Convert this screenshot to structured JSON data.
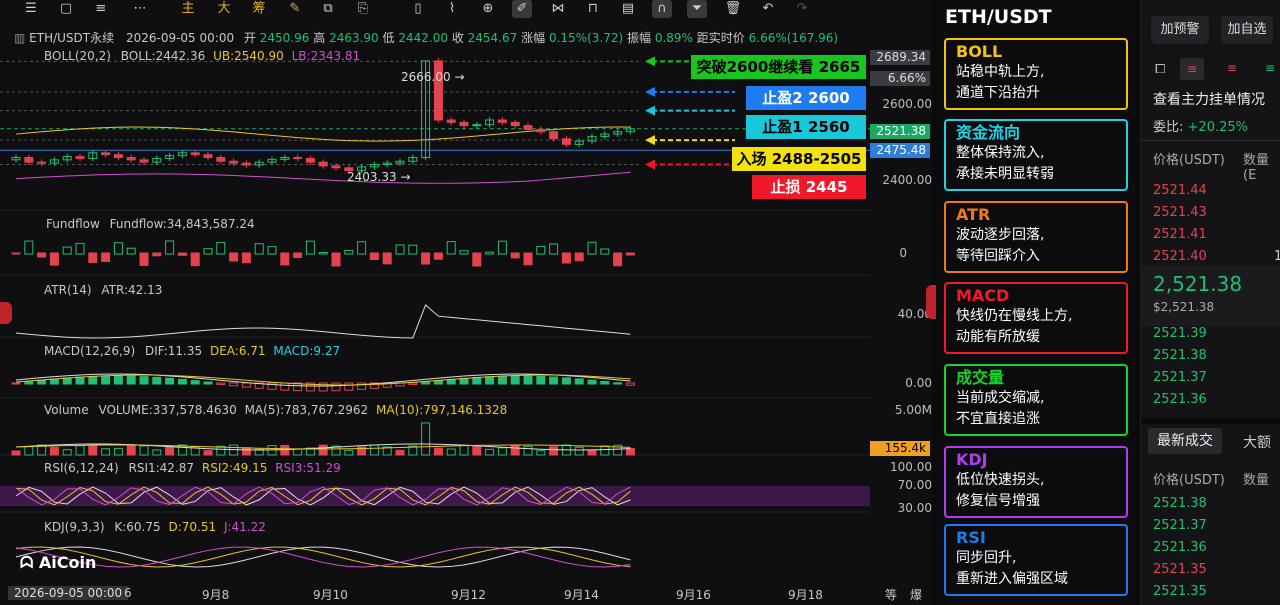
{
  "toolbar": {
    "icons": [
      "menu-icon",
      "square-icon",
      "sliders-icon",
      "more-dots-icon"
    ],
    "buttons": [
      "主",
      "大",
      "筹"
    ],
    "tools": [
      "draw-icon",
      "copy-icon",
      "bookmark-icon",
      "ruler-icon",
      "zoom-icon",
      "pen-icon",
      "symmetry-icon",
      "lock-icon",
      "note-icon",
      "magnet-icon",
      "filter-icon",
      "trash-icon",
      "undo-icon",
      "redo-icon"
    ]
  },
  "header": {
    "symbol": "ETH/USDT永续",
    "time": "2026-09-05 00:00",
    "open_l": "开",
    "open": "2450.96",
    "high_l": "高",
    "high": "2463.90",
    "low_l": "低",
    "low": "2442.00",
    "close_l": "收",
    "close": "2454.67",
    "chg_l": "涨幅",
    "chg": "0.15%(3.72)",
    "amp_l": "振幅",
    "amp": "0.89%",
    "dist_l": "距实时价",
    "dist": "6.66%(167.96)"
  },
  "boll": {
    "name": "BOLL(20,2)",
    "mid": "BOLL:2442.36",
    "ub": "UB:2540.90",
    "lb": "LB:2343.81"
  },
  "fundflow": {
    "name": "Fundflow",
    "value": "Fundflow:34,843,587.24"
  },
  "atr": {
    "name": "ATR(14)",
    "value": "ATR:42.13"
  },
  "macd": {
    "name": "MACD(12,26,9)",
    "dif": "DIF:11.35",
    "dea": "DEA:6.71",
    "macd": "MACD:9.27"
  },
  "volume": {
    "name": "Volume",
    "vol": "VOLUME:337,578.4630",
    "ma5": "MA(5):783,767.2962",
    "ma10": "MA(10):797,146.1328"
  },
  "rsi": {
    "name": "RSI(6,12,24)",
    "r1": "RSI1:42.87",
    "r2": "RSI2:49.15",
    "r3": "RSI3:51.29"
  },
  "kdj": {
    "name": "KDJ(9,3,3)",
    "k": "K:60.75",
    "d": "D:70.51",
    "j": "J:41.22"
  },
  "annot": {
    "high": "2666.00",
    "low": "2403.33"
  },
  "targets": [
    {
      "label": "突破2600继续看 2665",
      "bg": "#18c41e",
      "fg": "#000000"
    },
    {
      "label": "止盈2 2600",
      "bg": "#1e7bf0",
      "fg": "#ffffff"
    },
    {
      "label": "止盈1 2560",
      "bg": "#18c8d8",
      "fg": "#000000"
    },
    {
      "label": "入场 2488-2505",
      "bg": "#f2e10c",
      "fg": "#000000"
    },
    {
      "label": "止损 2445",
      "bg": "#f0192a",
      "fg": "#ffffff"
    }
  ],
  "price_axis": {
    "top_tag": "2689.34",
    "top_pct": "6.66%",
    "p2600": "2600.00",
    "last": "2521.38",
    "boll_mid": "2475.48",
    "p2400": "2400.00",
    "ff0": "0",
    "atr": "40.00",
    "macd0": "0.00",
    "vol5m": "5.00M",
    "vol_tag": "155.4k",
    "rsi100": "100.00",
    "rsi70": "70.00",
    "rsi30": "30.00"
  },
  "x_axis": {
    "first": "2026-09-05 00:00",
    "labels": [
      "6",
      "9月8",
      "9月10",
      "9月12",
      "9月14",
      "9月16",
      "9月18"
    ],
    "right1": "等",
    "right2": "爆"
  },
  "logo": "AiCoin",
  "panel": {
    "title": "ETH/USDT",
    "cards": [
      {
        "head": "BOLL",
        "line1": "站稳中轨上方,",
        "line2": "通道下沿抬升",
        "color": "#f2c40f",
        "headcolor": "#f2c40f"
      },
      {
        "head": "资金流向",
        "line1": "整体保持流入,",
        "line2": "承接未明显转弱",
        "color": "#1fd3e6",
        "headcolor": "#1fd3e6"
      },
      {
        "head": "ATR",
        "line1": "波动逐步回落,",
        "line2": "等待回踩介入",
        "color": "#f07b12",
        "headcolor": "#f07b12"
      },
      {
        "head": "MACD",
        "line1": "快线仍在慢线上方,",
        "line2": "动能有所放缓",
        "color": "#f0192a",
        "headcolor": "#f0192a"
      },
      {
        "head": "成交量",
        "line1": "当前成交缩减,",
        "line2": "不宜直接追涨",
        "color": "#18d42a",
        "headcolor": "#18d42a"
      },
      {
        "head": "KDJ",
        "line1": "低位快速拐头,",
        "line2": "修复信号增强",
        "color": "#b33cf0",
        "headcolor": "#b33cf0"
      },
      {
        "head": "RSI",
        "line1": "同步回升,",
        "line2": "重新进入偏强区域",
        "color": "#1e7bf0",
        "headcolor": "#1e7bf0"
      }
    ]
  },
  "depth": {
    "btn_alert": "加预警",
    "btn_fav": "加自选",
    "orders_title": "查看主力挂单情况",
    "ratio_l": "委比:",
    "ratio": "+20.25%",
    "col_price": "价格(USDT)",
    "col_qty": "数量 (E",
    "asks": [
      "2521.44",
      "2521.43",
      "2521.41",
      "2521.40"
    ],
    "ask_vol": "1",
    "last": "2,521.38",
    "last_usd": "$2,521.38",
    "bids": [
      "2521.39",
      "2521.38",
      "2521.37",
      "2521.36"
    ],
    "tab_latest": "最新成交",
    "tab_big": "大额",
    "trades_col": "价格(USDT)",
    "trades_qty": "数量",
    "trades": [
      {
        "p": "2521.38",
        "side": "buy"
      },
      {
        "p": "2521.37",
        "side": "buy"
      },
      {
        "p": "2521.36",
        "side": "buy"
      },
      {
        "p": "2521.35",
        "side": "sell"
      },
      {
        "p": "2521.35",
        "side": "buy"
      }
    ]
  },
  "chart_data": {
    "type": "candlestick",
    "close_series": [
      2460,
      2450,
      2448,
      2455,
      2462,
      2458,
      2470,
      2466,
      2460,
      2455,
      2450,
      2458,
      2464,
      2470,
      2466,
      2460,
      2452,
      2448,
      2444,
      2450,
      2456,
      2460,
      2458,
      2450,
      2442,
      2438,
      2432,
      2440,
      2445,
      2448,
      2452,
      2460,
      2666,
      2540,
      2535,
      2528,
      2530,
      2540,
      2535,
      2528,
      2520,
      2515,
      2500,
      2488,
      2495,
      2505,
      2510,
      2515,
      2521
    ]
  }
}
